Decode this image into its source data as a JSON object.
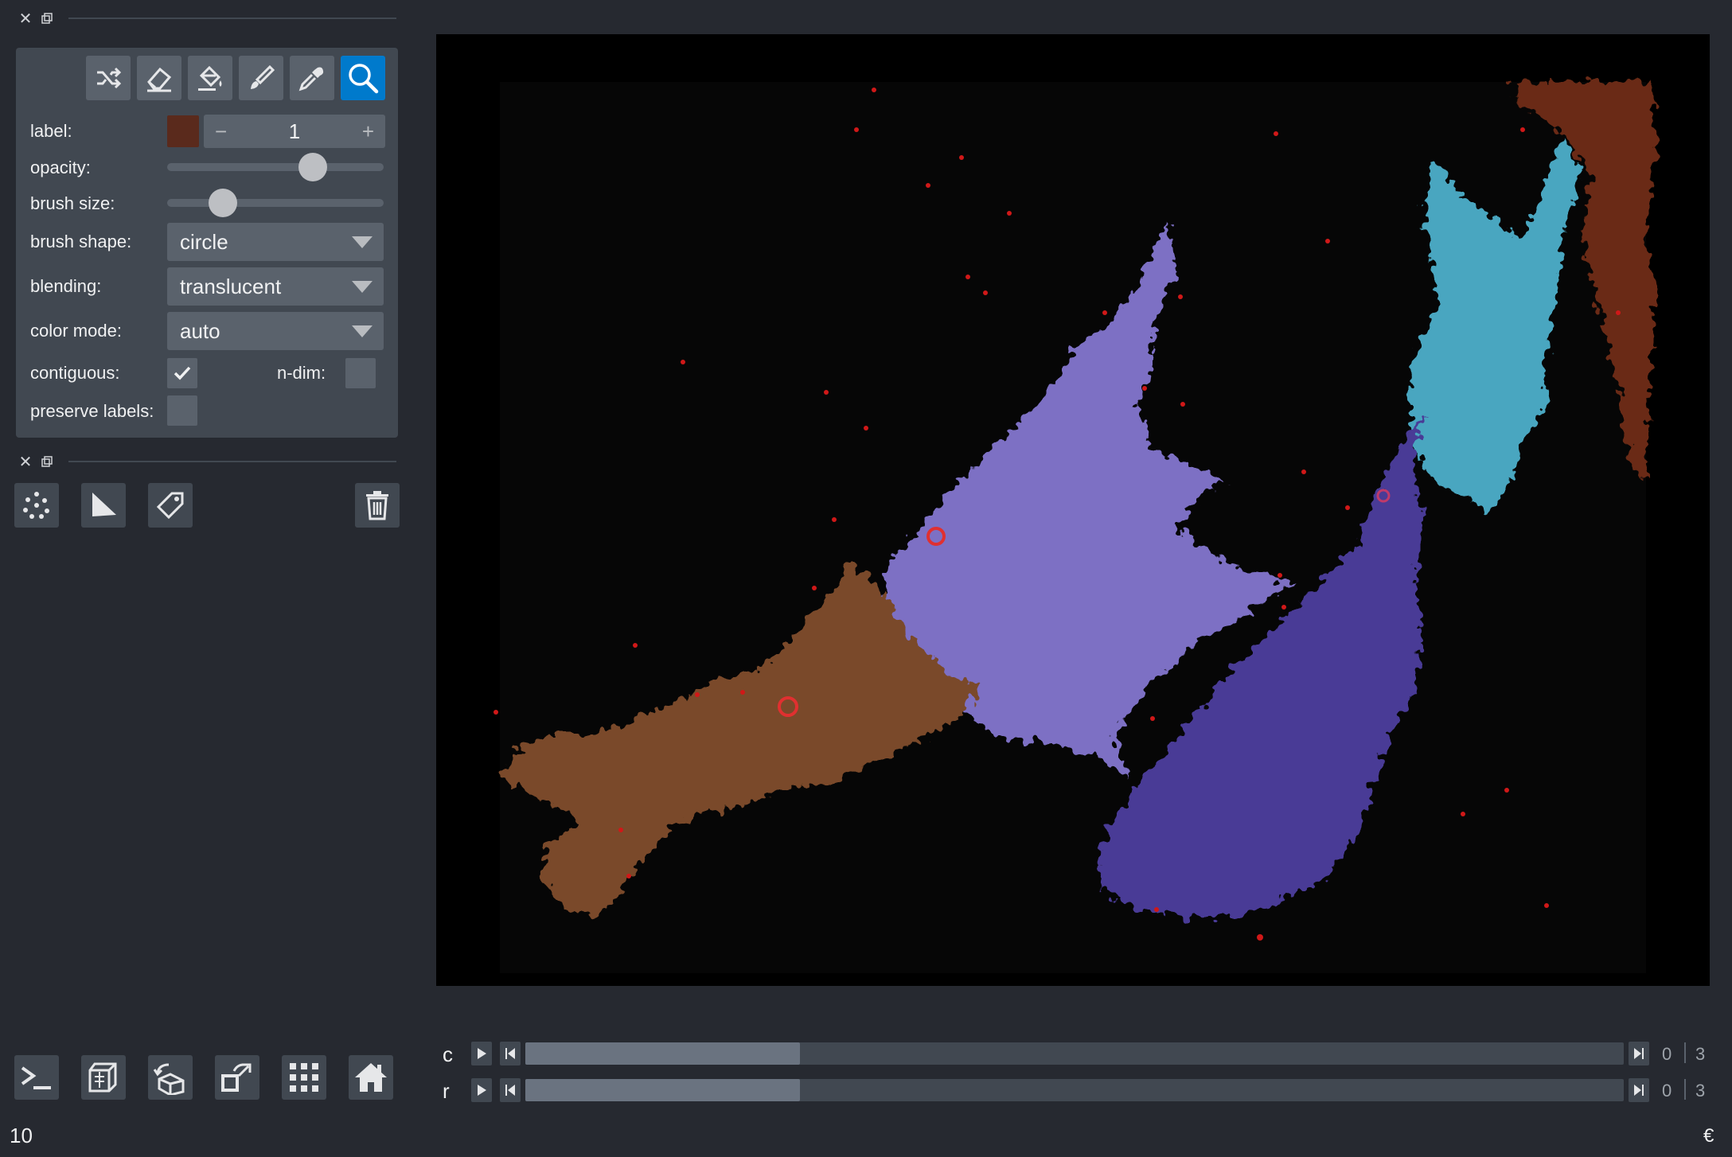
{
  "layer_controls": {
    "close_glyph": "✕",
    "tools": [
      {
        "name": "shuffle-colors-icon"
      },
      {
        "name": "eraser-icon"
      },
      {
        "name": "fill-bucket-icon"
      },
      {
        "name": "paintbrush-icon"
      },
      {
        "name": "color-picker-icon"
      },
      {
        "name": "zoom-pan-icon",
        "active": true
      }
    ],
    "label": {
      "text": "label:",
      "value": "1",
      "minus": "−",
      "plus": "+",
      "color": "#5a2a1c"
    },
    "opacity": {
      "text": "opacity:",
      "value": 0.7
    },
    "brush_size": {
      "text": "brush size:",
      "value": 0.2
    },
    "brush_shape": {
      "text": "brush shape:",
      "value": "circle"
    },
    "blending": {
      "text": "blending:",
      "value": "translucent"
    },
    "color_mode": {
      "text": "color mode:",
      "value": "auto"
    },
    "contiguous": {
      "text": "contiguous:",
      "checked": true
    },
    "n_dim": {
      "text": "n-dim:",
      "checked": false
    },
    "preserve_labels": {
      "text": "preserve labels:",
      "checked": false
    }
  },
  "layer_list": {
    "close_glyph": "✕",
    "buttons": [
      "new-points-icon",
      "new-shapes-icon",
      "new-labels-icon",
      "delete-layer-icon"
    ]
  },
  "viewer_buttons": [
    "console-icon",
    "ndisplay-icon",
    "roll-dims-icon",
    "transpose-icon",
    "grid-icon",
    "home-icon"
  ],
  "dims": [
    {
      "axis": "c",
      "current": "0",
      "max": "3",
      "fraction": 0.25
    },
    {
      "axis": "r",
      "current": "0",
      "max": "3",
      "fraction": 0.25
    }
  ],
  "status": {
    "left": "10",
    "right": "€"
  },
  "colors": {
    "background": "#262930",
    "panel": "#414851",
    "button": "#5a626c",
    "accent": "#007acc",
    "label_orange": "#7a4a2a",
    "label_lavender": "#7d70c4",
    "label_indigo": "#4a3b96",
    "label_cyan": "#4aa6c0",
    "label_rust": "#6a2c14"
  }
}
